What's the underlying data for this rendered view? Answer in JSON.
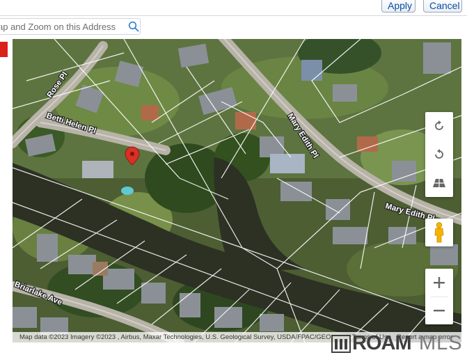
{
  "toolbar": {
    "apply_label": "Apply",
    "cancel_label": "Cancel"
  },
  "search": {
    "placeholder": "ap and Zoom on this Address"
  },
  "map": {
    "street_labels": [
      "Rose Pl",
      "Betti Helen Pl",
      "Mary Edith Pl",
      "Mary Edith Pl",
      "Briarlake Ave"
    ],
    "attribution": "Map data ©2023 Imagery ©2023 , Airbus, Maxar Technologies, U.S. Geological Survey, USDA/FPAC/GEO",
    "terms_label": "Terms of Use",
    "report_label": "Report a map error",
    "marker_color": "#d93025",
    "water_color": "#2c3124",
    "lot_line_color": "#ffffff"
  },
  "brand": {
    "name_bold": "ROAM",
    "name_light": "MLS"
  },
  "colors": {
    "accent_text": "#0b4ea2",
    "badge_red": "#d9221c"
  }
}
